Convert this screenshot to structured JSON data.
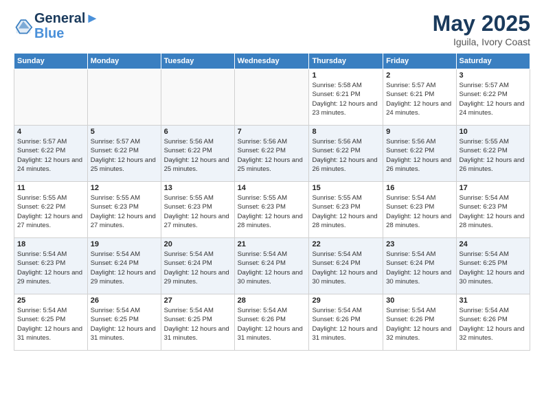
{
  "header": {
    "logo_line1": "General",
    "logo_line2": "Blue",
    "month_year": "May 2025",
    "location": "Iguila, Ivory Coast"
  },
  "weekdays": [
    "Sunday",
    "Monday",
    "Tuesday",
    "Wednesday",
    "Thursday",
    "Friday",
    "Saturday"
  ],
  "weeks": [
    [
      {
        "day": "",
        "sunrise": "",
        "sunset": "",
        "daylight": ""
      },
      {
        "day": "",
        "sunrise": "",
        "sunset": "",
        "daylight": ""
      },
      {
        "day": "",
        "sunrise": "",
        "sunset": "",
        "daylight": ""
      },
      {
        "day": "",
        "sunrise": "",
        "sunset": "",
        "daylight": ""
      },
      {
        "day": "1",
        "sunrise": "Sunrise: 5:58 AM",
        "sunset": "Sunset: 6:21 PM",
        "daylight": "Daylight: 12 hours and 23 minutes."
      },
      {
        "day": "2",
        "sunrise": "Sunrise: 5:57 AM",
        "sunset": "Sunset: 6:21 PM",
        "daylight": "Daylight: 12 hours and 24 minutes."
      },
      {
        "day": "3",
        "sunrise": "Sunrise: 5:57 AM",
        "sunset": "Sunset: 6:22 PM",
        "daylight": "Daylight: 12 hours and 24 minutes."
      }
    ],
    [
      {
        "day": "4",
        "sunrise": "Sunrise: 5:57 AM",
        "sunset": "Sunset: 6:22 PM",
        "daylight": "Daylight: 12 hours and 24 minutes."
      },
      {
        "day": "5",
        "sunrise": "Sunrise: 5:57 AM",
        "sunset": "Sunset: 6:22 PM",
        "daylight": "Daylight: 12 hours and 25 minutes."
      },
      {
        "day": "6",
        "sunrise": "Sunrise: 5:56 AM",
        "sunset": "Sunset: 6:22 PM",
        "daylight": "Daylight: 12 hours and 25 minutes."
      },
      {
        "day": "7",
        "sunrise": "Sunrise: 5:56 AM",
        "sunset": "Sunset: 6:22 PM",
        "daylight": "Daylight: 12 hours and 25 minutes."
      },
      {
        "day": "8",
        "sunrise": "Sunrise: 5:56 AM",
        "sunset": "Sunset: 6:22 PM",
        "daylight": "Daylight: 12 hours and 26 minutes."
      },
      {
        "day": "9",
        "sunrise": "Sunrise: 5:56 AM",
        "sunset": "Sunset: 6:22 PM",
        "daylight": "Daylight: 12 hours and 26 minutes."
      },
      {
        "day": "10",
        "sunrise": "Sunrise: 5:55 AM",
        "sunset": "Sunset: 6:22 PM",
        "daylight": "Daylight: 12 hours and 26 minutes."
      }
    ],
    [
      {
        "day": "11",
        "sunrise": "Sunrise: 5:55 AM",
        "sunset": "Sunset: 6:22 PM",
        "daylight": "Daylight: 12 hours and 27 minutes."
      },
      {
        "day": "12",
        "sunrise": "Sunrise: 5:55 AM",
        "sunset": "Sunset: 6:23 PM",
        "daylight": "Daylight: 12 hours and 27 minutes."
      },
      {
        "day": "13",
        "sunrise": "Sunrise: 5:55 AM",
        "sunset": "Sunset: 6:23 PM",
        "daylight": "Daylight: 12 hours and 27 minutes."
      },
      {
        "day": "14",
        "sunrise": "Sunrise: 5:55 AM",
        "sunset": "Sunset: 6:23 PM",
        "daylight": "Daylight: 12 hours and 28 minutes."
      },
      {
        "day": "15",
        "sunrise": "Sunrise: 5:55 AM",
        "sunset": "Sunset: 6:23 PM",
        "daylight": "Daylight: 12 hours and 28 minutes."
      },
      {
        "day": "16",
        "sunrise": "Sunrise: 5:54 AM",
        "sunset": "Sunset: 6:23 PM",
        "daylight": "Daylight: 12 hours and 28 minutes."
      },
      {
        "day": "17",
        "sunrise": "Sunrise: 5:54 AM",
        "sunset": "Sunset: 6:23 PM",
        "daylight": "Daylight: 12 hours and 28 minutes."
      }
    ],
    [
      {
        "day": "18",
        "sunrise": "Sunrise: 5:54 AM",
        "sunset": "Sunset: 6:23 PM",
        "daylight": "Daylight: 12 hours and 29 minutes."
      },
      {
        "day": "19",
        "sunrise": "Sunrise: 5:54 AM",
        "sunset": "Sunset: 6:24 PM",
        "daylight": "Daylight: 12 hours and 29 minutes."
      },
      {
        "day": "20",
        "sunrise": "Sunrise: 5:54 AM",
        "sunset": "Sunset: 6:24 PM",
        "daylight": "Daylight: 12 hours and 29 minutes."
      },
      {
        "day": "21",
        "sunrise": "Sunrise: 5:54 AM",
        "sunset": "Sunset: 6:24 PM",
        "daylight": "Daylight: 12 hours and 30 minutes."
      },
      {
        "day": "22",
        "sunrise": "Sunrise: 5:54 AM",
        "sunset": "Sunset: 6:24 PM",
        "daylight": "Daylight: 12 hours and 30 minutes."
      },
      {
        "day": "23",
        "sunrise": "Sunrise: 5:54 AM",
        "sunset": "Sunset: 6:24 PM",
        "daylight": "Daylight: 12 hours and 30 minutes."
      },
      {
        "day": "24",
        "sunrise": "Sunrise: 5:54 AM",
        "sunset": "Sunset: 6:25 PM",
        "daylight": "Daylight: 12 hours and 30 minutes."
      }
    ],
    [
      {
        "day": "25",
        "sunrise": "Sunrise: 5:54 AM",
        "sunset": "Sunset: 6:25 PM",
        "daylight": "Daylight: 12 hours and 31 minutes."
      },
      {
        "day": "26",
        "sunrise": "Sunrise: 5:54 AM",
        "sunset": "Sunset: 6:25 PM",
        "daylight": "Daylight: 12 hours and 31 minutes."
      },
      {
        "day": "27",
        "sunrise": "Sunrise: 5:54 AM",
        "sunset": "Sunset: 6:25 PM",
        "daylight": "Daylight: 12 hours and 31 minutes."
      },
      {
        "day": "28",
        "sunrise": "Sunrise: 5:54 AM",
        "sunset": "Sunset: 6:26 PM",
        "daylight": "Daylight: 12 hours and 31 minutes."
      },
      {
        "day": "29",
        "sunrise": "Sunrise: 5:54 AM",
        "sunset": "Sunset: 6:26 PM",
        "daylight": "Daylight: 12 hours and 31 minutes."
      },
      {
        "day": "30",
        "sunrise": "Sunrise: 5:54 AM",
        "sunset": "Sunset: 6:26 PM",
        "daylight": "Daylight: 12 hours and 32 minutes."
      },
      {
        "day": "31",
        "sunrise": "Sunrise: 5:54 AM",
        "sunset": "Sunset: 6:26 PM",
        "daylight": "Daylight: 12 hours and 32 minutes."
      }
    ]
  ]
}
